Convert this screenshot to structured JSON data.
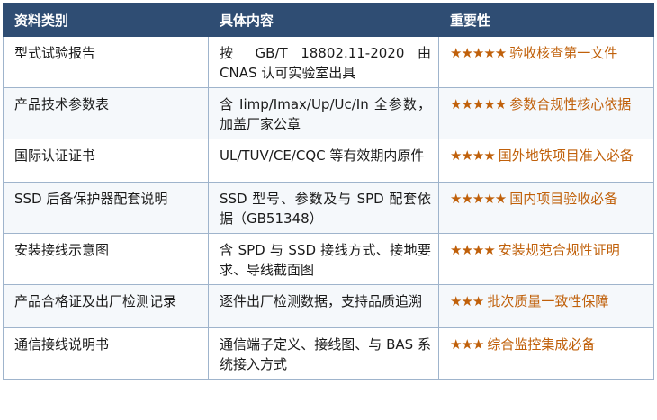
{
  "headers": [
    "资料类别",
    "具体内容",
    "重要性"
  ],
  "rows": [
    {
      "category": "型式试验报告",
      "content": "按 GB/T 18802.11-2020 由 CNAS 认可实验室出具",
      "stars": "★★★★★",
      "note": "验收核查第一文件"
    },
    {
      "category": "产品技术参数表",
      "content": "含 Iimp/Imax/Up/Uc/In 全参数，加盖厂家公章",
      "stars": "★★★★★",
      "note": "参数合规性核心依据"
    },
    {
      "category": "国际认证证书",
      "content": "UL/TUV/CE/CQC 等有效期内原件",
      "stars": "★★★★",
      "note": "国外地铁项目准入必备"
    },
    {
      "category": "SSD 后备保护器配套说明",
      "content": "SSD 型号、参数及与 SPD 配套依据（GB51348）",
      "stars": "★★★★★",
      "note": "国内项目验收必备"
    },
    {
      "category": "安装接线示意图",
      "content": "含 SPD 与 SSD 接线方式、接地要求、导线截面图",
      "stars": "★★★★",
      "note": "安装规范合规性证明"
    },
    {
      "category": "产品合格证及出厂检测记录",
      "content": "逐件出厂检测数据，支持品质追溯",
      "stars": "★★★",
      "note": "批次质量一致性保障"
    },
    {
      "category": "通信接线说明书",
      "content": "通信端子定义、接线图、与 BAS 系统接入方式",
      "stars": "★★★",
      "note": "综合监控集成必备"
    }
  ]
}
